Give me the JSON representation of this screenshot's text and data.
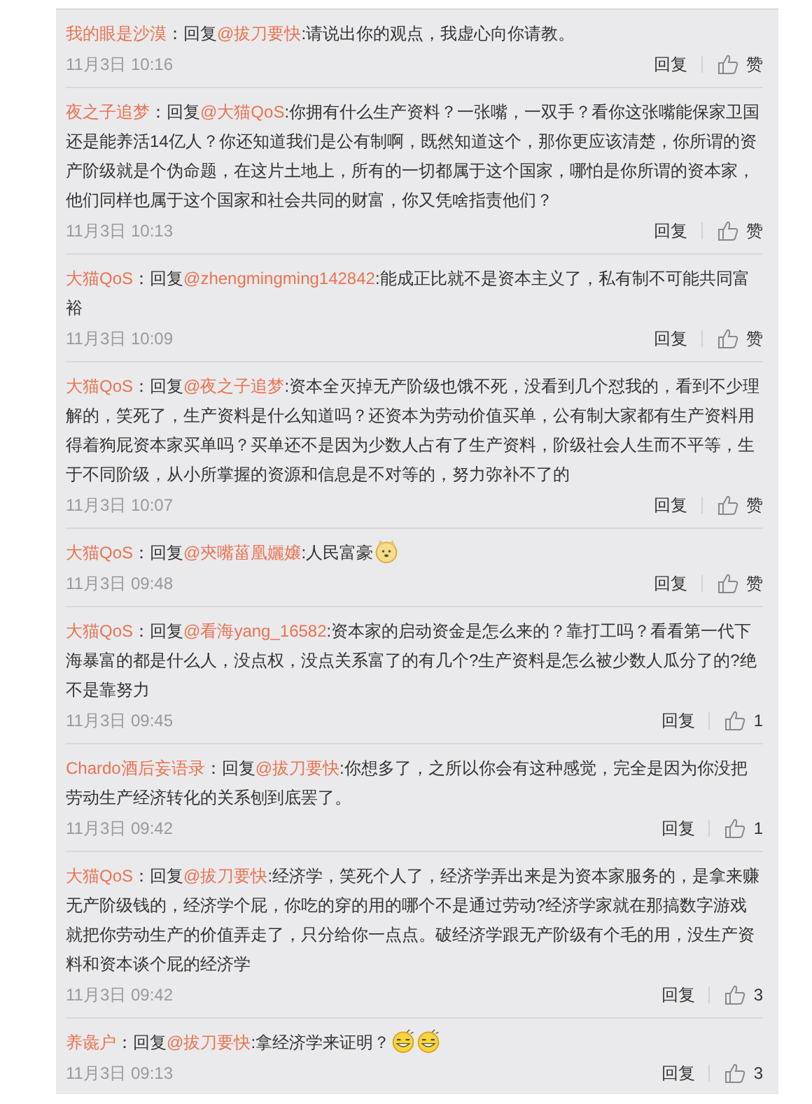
{
  "comments": [
    {
      "author": "我的眼是沙漠",
      "prefix": "：回复",
      "mention": "@拔刀要快",
      "text": ":请说出你的观点，我虚心向你请教。",
      "time": "11月3日 10:16",
      "reply": "回复",
      "like": "赞"
    },
    {
      "author": "夜之子追梦",
      "prefix": "：回复",
      "mention": "@大猫QoS",
      "text": ":你拥有什么生产资料？一张嘴，一双手？看你这张嘴能保家卫国还是能养活14亿人？你还知道我们是公有制啊，既然知道这个，那你更应该清楚，你所谓的资产阶级就是个伪命题，在这片土地上，所有的一切都属于这个国家，哪怕是你所谓的资本家，他们同样也属于这个国家和社会共同的财富，你又凭啥指责他们？",
      "time": "11月3日 10:13",
      "reply": "回复",
      "like": "赞"
    },
    {
      "author": "大猫QoS",
      "prefix": "：回复",
      "mention": "@zhengmingming142842",
      "text": ":能成正比就不是资本主义了，私有制不可能共同富裕",
      "time": "11月3日 10:09",
      "reply": "回复",
      "like": "赞"
    },
    {
      "author": "大猫QoS",
      "prefix": "：回复",
      "mention": "@夜之子追梦",
      "text": ":资本全灭掉无产阶级也饿不死，没看到几个怼我的，看到不少理解的，笑死了，生产资料是什么知道吗？还资本为劳动价值买单，公有制大家都有生产资料用得着狗屁资本家买单吗？买单还不是因为少数人占有了生产资料，阶级社会人生而不平等，生于不同阶级，从小所掌握的资源和信息是不对等的，努力弥补不了的",
      "time": "11月3日 10:07",
      "reply": "回复",
      "like": "赞"
    },
    {
      "author": "大猫QoS",
      "prefix": "：回复",
      "mention": "@㚒嘴菑凰孋嬢",
      "text": ":人民富豪",
      "emojis": [
        {
          "kind": "doge"
        }
      ],
      "time": "11月3日 09:48",
      "reply": "回复",
      "like": "赞"
    },
    {
      "author": "大猫QoS",
      "prefix": "：回复",
      "mention": "@看海yang_16582",
      "text": ":资本家的启动资金是怎么来的？靠打工吗？看看第一代下海暴富的都是什么人，没点权，没点关系富了的有几个?生产资料是怎么被少数人瓜分了的?绝不是靠努力",
      "time": "11月3日 09:45",
      "reply": "回复",
      "like": "1"
    },
    {
      "author": "Chardo酒后妄语录",
      "prefix": "：回复",
      "mention": "@拔刀要快",
      "text": ":你想多了，之所以你会有这种感觉，完全是因为你没把劳动生产经济转化的关系刨到底罢了。",
      "time": "11月3日 09:42",
      "reply": "回复",
      "like": "1"
    },
    {
      "author": "大猫QoS",
      "prefix": "：回复",
      "mention": "@拔刀要快",
      "text": ":经济学，笑死个人了，经济学弄出来是为资本家服务的，是拿来赚无产阶级钱的，经济学个屁，你吃的穿的用的哪个不是通过劳动?经济学家就在那搞数字游戏就把你劳动生产的价值弄走了，只分给你一点点。破经济学跟无产阶级有个毛的用，没生产资料和资本谈个屁的经济学",
      "time": "11月3日 09:42",
      "reply": "回复",
      "like": "3"
    },
    {
      "author": "养彘户",
      "prefix": "：回复",
      "mention": "@拔刀要快",
      "text": ":拿经济学来证明？",
      "emojis": [
        {
          "kind": "grin"
        },
        {
          "kind": "grin"
        }
      ],
      "time": "11月3日 09:13",
      "reply": "回复",
      "like": "3"
    }
  ]
}
